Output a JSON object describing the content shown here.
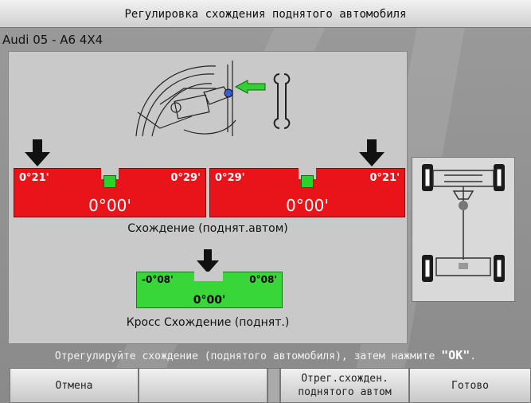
{
  "window": {
    "title": "Регулировка схождения поднятого автомобиля"
  },
  "vehicle": "Audi 05 - A6 4X4",
  "left_scale": {
    "left_value": "0°21'",
    "right_value": "0°29'",
    "center_value": "0°00'"
  },
  "right_scale": {
    "left_value": "0°29'",
    "right_value": "0°21'",
    "center_value": "0°00'"
  },
  "toe_caption": "Схождение (поднят.автом)",
  "cross_scale": {
    "left_value": "-0°08'",
    "right_value": "0°08'",
    "center_value": "0°00'"
  },
  "cross_caption": "Кросс Схождение (поднят.)",
  "status": {
    "text": "Отрегулируйте схождение (поднятого автомобиля), затем нажмите ",
    "ok": "\"OK\"",
    "end": "."
  },
  "softkeys": {
    "cancel": "Отмена",
    "blank": "",
    "adjust_line1": "Отрег.схожден.",
    "adjust_line2": "поднятого автом",
    "done": "Готово"
  },
  "colors": {
    "red_scale": "#e8141a",
    "green_scale": "#39d63a",
    "arrow_green": "#35d035"
  }
}
